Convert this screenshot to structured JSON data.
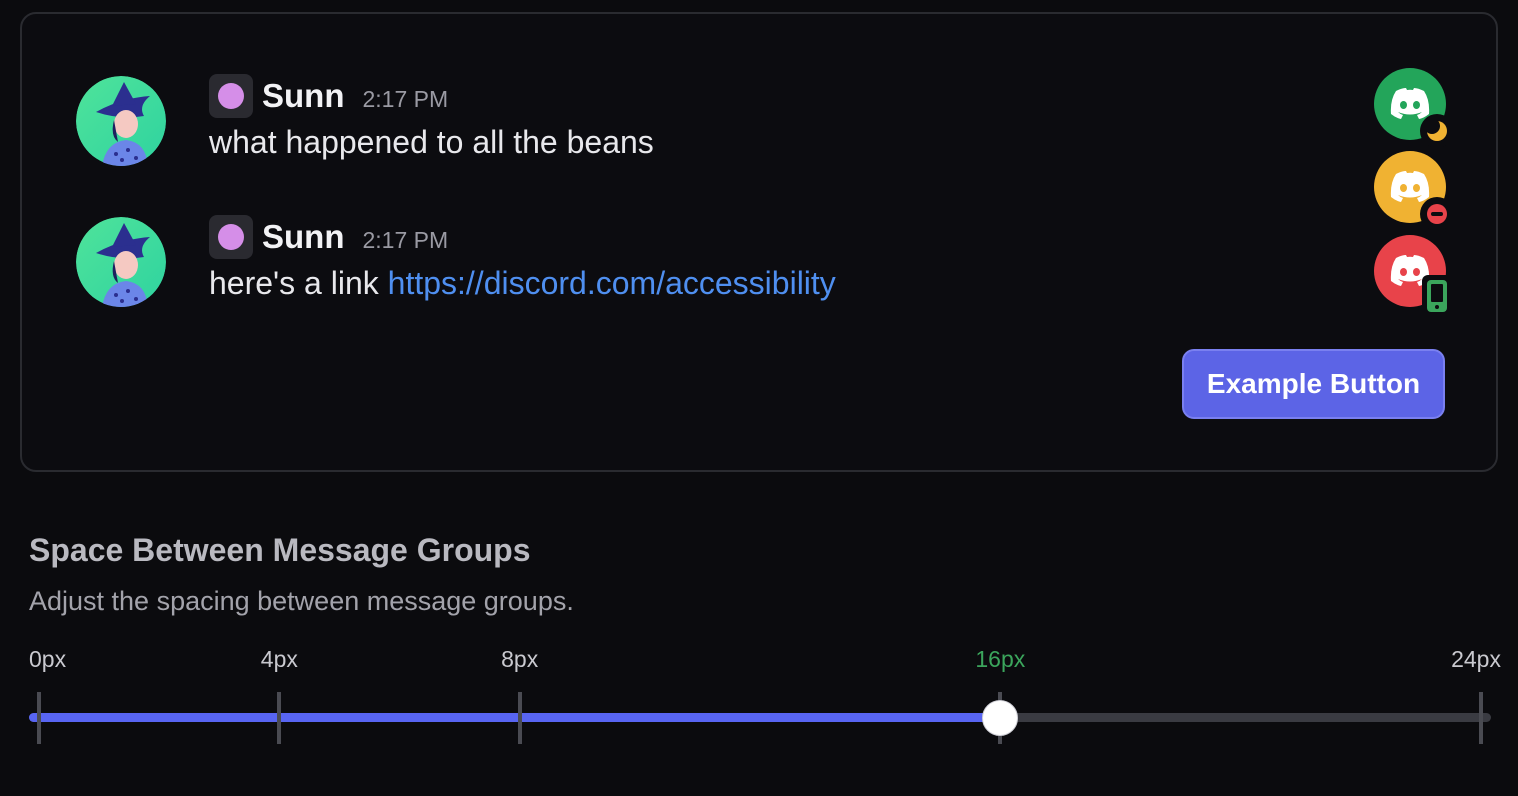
{
  "preview": {
    "messages": [
      {
        "username": "Sunn",
        "timestamp": "2:17 PM",
        "text": "what happened to all the beans"
      },
      {
        "username": "Sunn",
        "timestamp": "2:17 PM",
        "text_prefix": "here's a link ",
        "link": "https://discord.com/accessibility"
      }
    ],
    "bot_avatars": [
      {
        "color": "#23a55a",
        "status": "idle-moon-icon"
      },
      {
        "color": "#f0b232",
        "status": "do-not-disturb-icon"
      },
      {
        "color": "#e8434a",
        "status": "mobile-phone-icon"
      }
    ],
    "example_button_label": "Example Button"
  },
  "setting": {
    "title": "Space Between Message Groups",
    "description": "Adjust the spacing between message groups.",
    "slider": {
      "min": 0,
      "max": 24,
      "value": 16,
      "unit": "px",
      "ticks": [
        {
          "value": 0,
          "label": "0px"
        },
        {
          "value": 4,
          "label": "4px"
        },
        {
          "value": 8,
          "label": "8px"
        },
        {
          "value": 16,
          "label": "16px"
        },
        {
          "value": 24,
          "label": "24px"
        }
      ],
      "fill_color": "#5865f2",
      "active_label_color": "#3ba55c"
    }
  }
}
